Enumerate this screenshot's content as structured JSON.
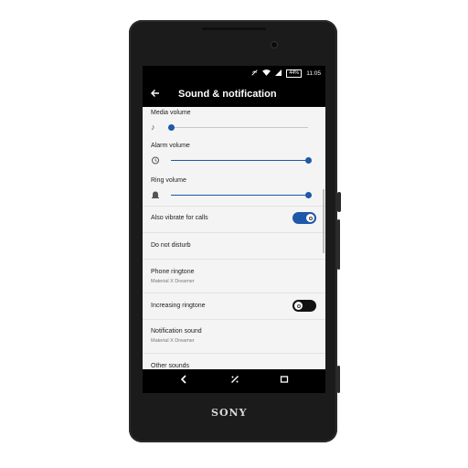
{
  "status_bar": {
    "battery": "44%",
    "time": "11:05",
    "icons": [
      "no-sound-icon",
      "wifi-icon",
      "signal-icon",
      "battery-icon"
    ]
  },
  "app_bar": {
    "title": "Sound & notification",
    "back_icon": "arrow-back-icon"
  },
  "settings": {
    "media_volume": {
      "label": "Media volume",
      "icon": "music-note-icon",
      "level": 0
    },
    "alarm_volume": {
      "label": "Alarm volume",
      "icon": "alarm-clock-icon",
      "level": 1.0
    },
    "ring_volume": {
      "label": "Ring volume",
      "icon": "bell-icon",
      "level": 1.0
    },
    "vibrate_calls": {
      "label": "Also vibrate for calls",
      "on": true
    },
    "do_not_disturb": {
      "label": "Do not disturb"
    },
    "phone_ringtone": {
      "label": "Phone ringtone",
      "value": "Material X Dreamer"
    },
    "increasing_ringtone": {
      "label": "Increasing ringtone",
      "on": false
    },
    "notification_sound": {
      "label": "Notification sound",
      "value": "Material X Dreamer"
    },
    "other_sounds": {
      "label": "Other sounds"
    }
  },
  "nav_bar": {
    "items": [
      "back-icon",
      "home-icon",
      "recents-icon"
    ]
  },
  "device": {
    "brand": "SONY"
  },
  "colors": {
    "accent": "#1f58a8",
    "screen_bg": "#f4f4f4",
    "bar_bg": "#000000"
  }
}
